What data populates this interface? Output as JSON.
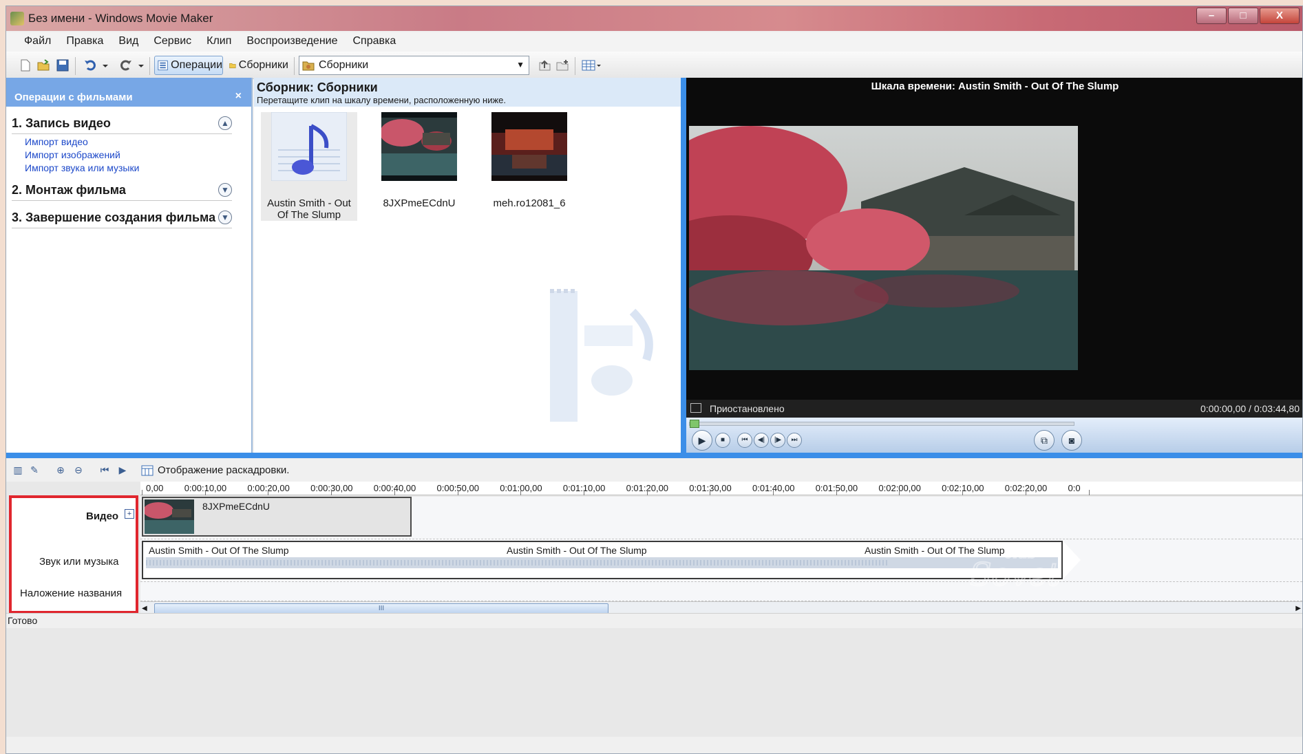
{
  "window": {
    "title": "Без имени - Windows Movie Maker",
    "controls": [
      "–",
      "□",
      "X"
    ]
  },
  "menu": [
    "Файл",
    "Правка",
    "Вид",
    "Сервис",
    "Клип",
    "Воспроизведение",
    "Справка"
  ],
  "toolbar": {
    "operations_label": "Операции",
    "collections_label": "Сборники",
    "collections_select_value": "Сборники"
  },
  "taskpane": {
    "header": "Операции с фильмами",
    "close": "×",
    "sections": [
      {
        "title": "1. Запись видео",
        "expanded": true,
        "links": [
          "Импорт видео",
          "Импорт изображений",
          "Импорт звука или музыки"
        ]
      },
      {
        "title": "2. Монтаж фильма",
        "expanded": false,
        "links": []
      },
      {
        "title": "3. Завершение создания фильма",
        "expanded": false,
        "links": []
      }
    ]
  },
  "collection": {
    "title": "Сборник: Сборники",
    "hint": "Перетащите клип на шкалу времени, расположенную ниже.",
    "clips": [
      {
        "name": "Austin Smith - Out Of The Slump",
        "type": "audio"
      },
      {
        "name": "8JXPmeECdnU",
        "type": "video"
      },
      {
        "name": "meh.ro12081_6",
        "type": "image"
      }
    ]
  },
  "preview": {
    "title": "Шкала времени: Austin Smith - Out Of The Slump",
    "status": "Приостановлено",
    "time": "0:00:00,00 / 0:03:44,80",
    "buttons": [
      "▶",
      "■",
      "⏮",
      "◀|",
      "|▶",
      "⏭"
    ],
    "progress": 0
  },
  "timeline": {
    "storyboard_label": "Отображение раскадровки.",
    "ruler": [
      "0,00",
      "0:00:10,00",
      "0:00:20,00",
      "0:00:30,00",
      "0:00:40,00",
      "0:00:50,00",
      "0:01:00,00",
      "0:01:10,00",
      "0:01:20,00",
      "0:01:30,00",
      "0:01:40,00",
      "0:01:50,00",
      "0:02:00,00",
      "0:02:10,00",
      "0:02:20,00",
      "0:0"
    ],
    "tracks": {
      "video": "Видео",
      "audio": "Звук или музыка",
      "title": "Наложение названия",
      "expand": "+"
    },
    "video_clip": "8JXPmeECdnU",
    "audio_clip_labels": [
      "Austin Smith - Out Of The Slump",
      "Austin Smith - Out Of The Slump",
      "Austin Smith - Out Of The Slump"
    ],
    "scroll_grip": "III"
  },
  "status_bar": "Готово",
  "colors": {
    "accent": "#3b8ee8",
    "highlight_box": "#e0262e",
    "taskpane_header": "#77a7e6"
  }
}
